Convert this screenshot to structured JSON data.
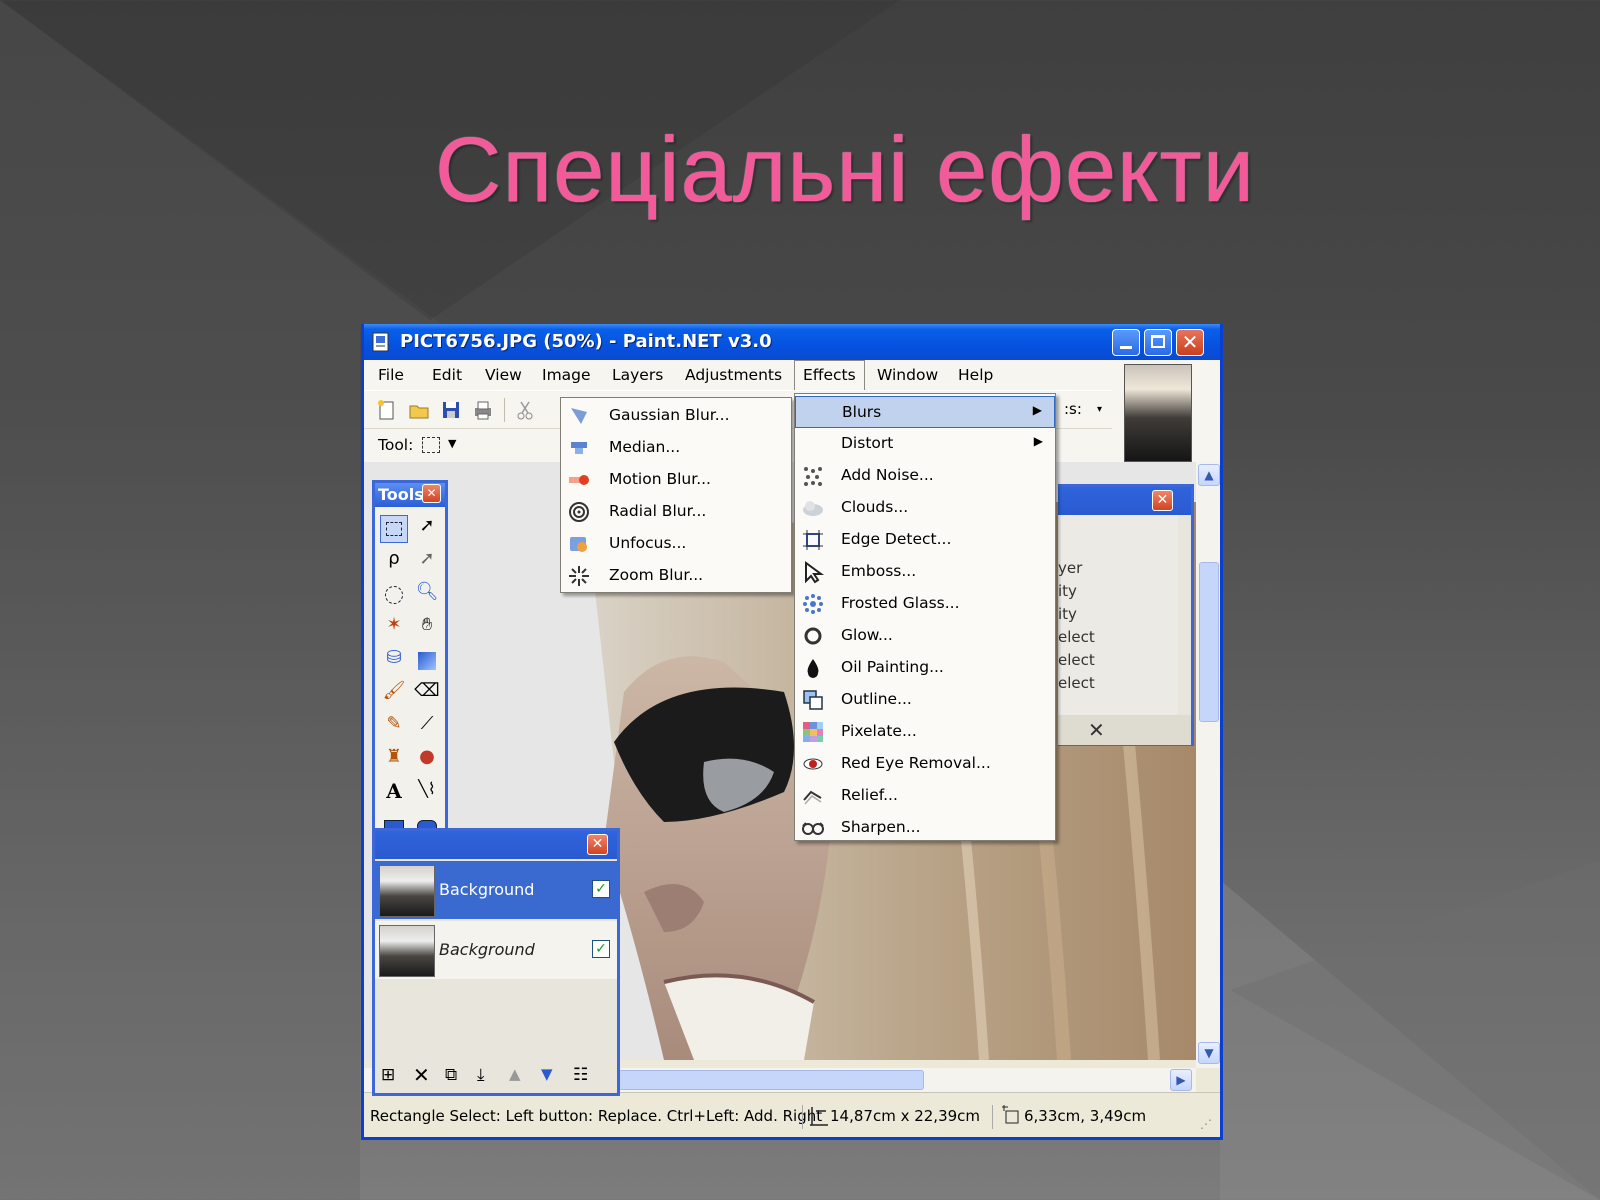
{
  "slide": {
    "title": "Спеціальні ефекти"
  },
  "window": {
    "title": "PICT6756.JPG (50%) - Paint.NET v3.0",
    "menu": [
      "File",
      "Edit",
      "View",
      "Image",
      "Layers",
      "Adjustments",
      "Effects",
      "Window",
      "Help"
    ],
    "active_menu": "Effects",
    "toolbar": {
      "tool_label": "Tool:",
      "partial_label": ":s:",
      "icons": [
        "new-icon",
        "open-icon",
        "save-icon",
        "print-icon",
        "cut-icon"
      ]
    }
  },
  "blurs_submenu": [
    {
      "label": "Gaussian Blur...",
      "icon": "gaussian-blur-icon"
    },
    {
      "label": "Median...",
      "icon": "median-icon"
    },
    {
      "label": "Motion Blur...",
      "icon": "motion-blur-icon"
    },
    {
      "label": "Radial Blur...",
      "icon": "radial-blur-icon"
    },
    {
      "label": "Unfocus...",
      "icon": "unfocus-icon"
    },
    {
      "label": "Zoom Blur...",
      "icon": "zoom-blur-icon"
    }
  ],
  "effects_menu": [
    {
      "label": "Blurs",
      "submenu": true,
      "highlighted": true
    },
    {
      "label": "Distort",
      "submenu": true
    },
    {
      "label": "Add Noise...",
      "icon": "add-noise-icon"
    },
    {
      "label": "Clouds...",
      "icon": "clouds-icon"
    },
    {
      "label": "Edge Detect...",
      "icon": "edge-detect-icon"
    },
    {
      "label": "Emboss...",
      "icon": "emboss-icon"
    },
    {
      "label": "Frosted Glass...",
      "icon": "frosted-glass-icon"
    },
    {
      "label": "Glow...",
      "icon": "glow-icon"
    },
    {
      "label": "Oil Painting...",
      "icon": "oil-painting-icon"
    },
    {
      "label": "Outline...",
      "icon": "outline-icon"
    },
    {
      "label": "Pixelate...",
      "icon": "pixelate-icon"
    },
    {
      "label": "Red Eye Removal...",
      "icon": "red-eye-icon"
    },
    {
      "label": "Relief...",
      "icon": "relief-icon"
    },
    {
      "label": "Sharpen...",
      "icon": "sharpen-icon"
    }
  ],
  "tools_panel": {
    "title": "Tools"
  },
  "layers_panel": {
    "layers": [
      {
        "name": "Background",
        "visible": true,
        "selected": true
      },
      {
        "name": "Background",
        "visible": true,
        "selected": false
      }
    ]
  },
  "history_panel": {
    "lines": [
      "yer",
      "ity",
      "ity",
      "elect",
      "elect",
      "elect"
    ]
  },
  "status_bar": {
    "hint": "Rectangle Select: Left button: Replace. Ctrl+Left: Add. Right",
    "size": "14,87cm x 22,39cm",
    "position": "6,33cm, 3,49cm"
  },
  "colors": {
    "title_pink": "#f25a9a",
    "xp_blue": "#0a5fe8",
    "menu_highlight": "#c1d2ee"
  }
}
